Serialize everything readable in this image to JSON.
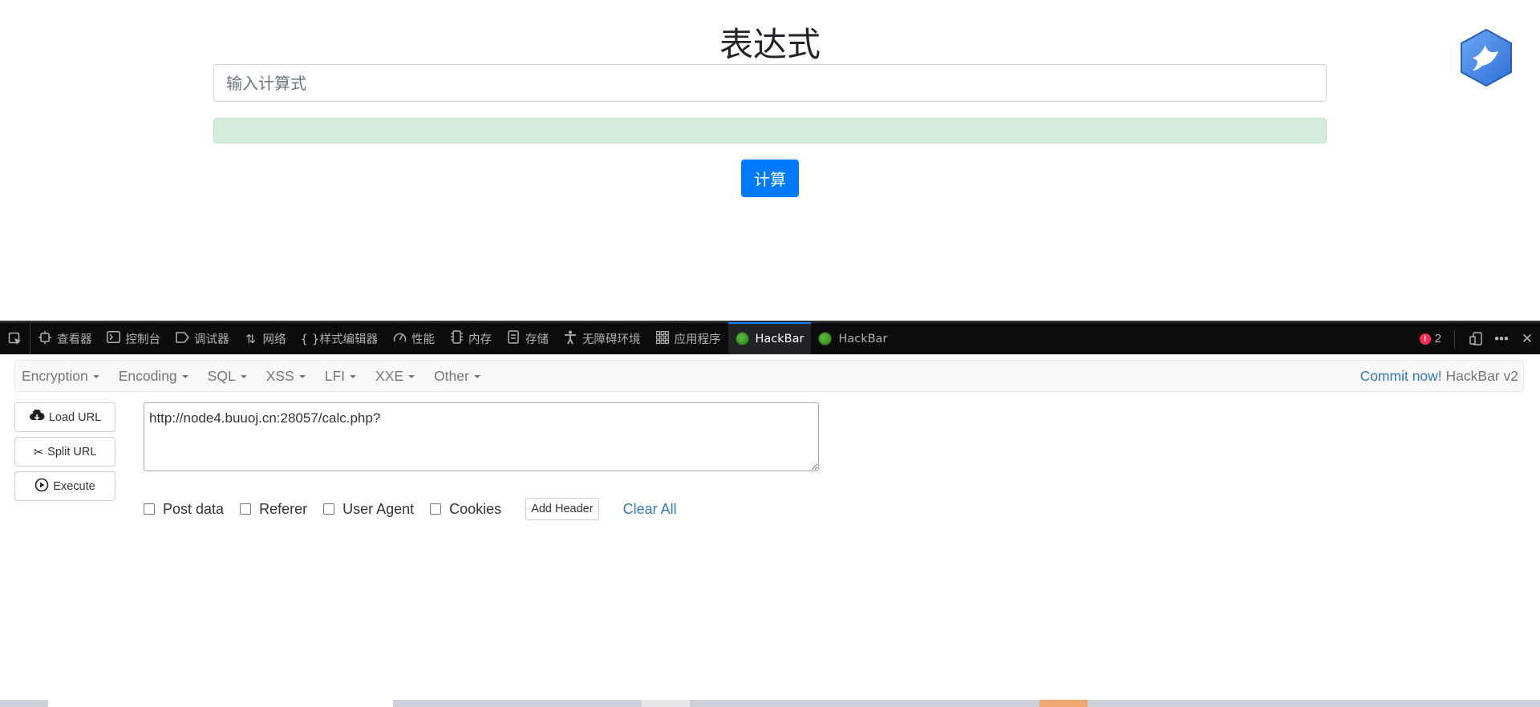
{
  "page": {
    "title": "表达式",
    "input_placeholder": "输入计算式",
    "input_value": "",
    "result_text": "",
    "submit_label": "计算"
  },
  "devtools": {
    "tabs": [
      {
        "label": "查看器",
        "icon": "inspector-icon"
      },
      {
        "label": "控制台",
        "icon": "console-icon"
      },
      {
        "label": "调试器",
        "icon": "debugger-icon"
      },
      {
        "label": "网络",
        "icon": "network-icon"
      },
      {
        "label": "样式编辑器",
        "icon": "style-editor-icon"
      },
      {
        "label": "性能",
        "icon": "performance-icon"
      },
      {
        "label": "内存",
        "icon": "memory-icon"
      },
      {
        "label": "存储",
        "icon": "storage-icon"
      },
      {
        "label": "无障碍环境",
        "icon": "accessibility-icon"
      },
      {
        "label": "应用程序",
        "icon": "application-icon"
      },
      {
        "label": "HackBar",
        "icon": "hackbar-icon",
        "active": true
      },
      {
        "label": "HackBar",
        "icon": "hackbar-icon"
      }
    ],
    "error_count": "2"
  },
  "hackbar": {
    "menus": [
      "Encryption",
      "Encoding",
      "SQL",
      "XSS",
      "LFI",
      "XXE",
      "Other"
    ],
    "commit_label": "Commit now!",
    "version_label": "HackBar v2",
    "load_url_label": "Load URL",
    "split_url_label": "Split URL",
    "execute_label": "Execute",
    "url_value": "http://node4.buuoj.cn:28057/calc.php?",
    "options": {
      "post_data": "Post data",
      "referer": "Referer",
      "user_agent": "User Agent",
      "cookies": "Cookies"
    },
    "add_header_label": "Add Header",
    "clear_all_label": "Clear All"
  },
  "colors": {
    "primary_button": "#007bff",
    "success_bg": "#d4edda",
    "devtools_bg": "#0c0c0d",
    "active_tab_accent": "#0a84ff",
    "hackbar_link": "#337ab7",
    "error_badge": "#ff2a51"
  }
}
